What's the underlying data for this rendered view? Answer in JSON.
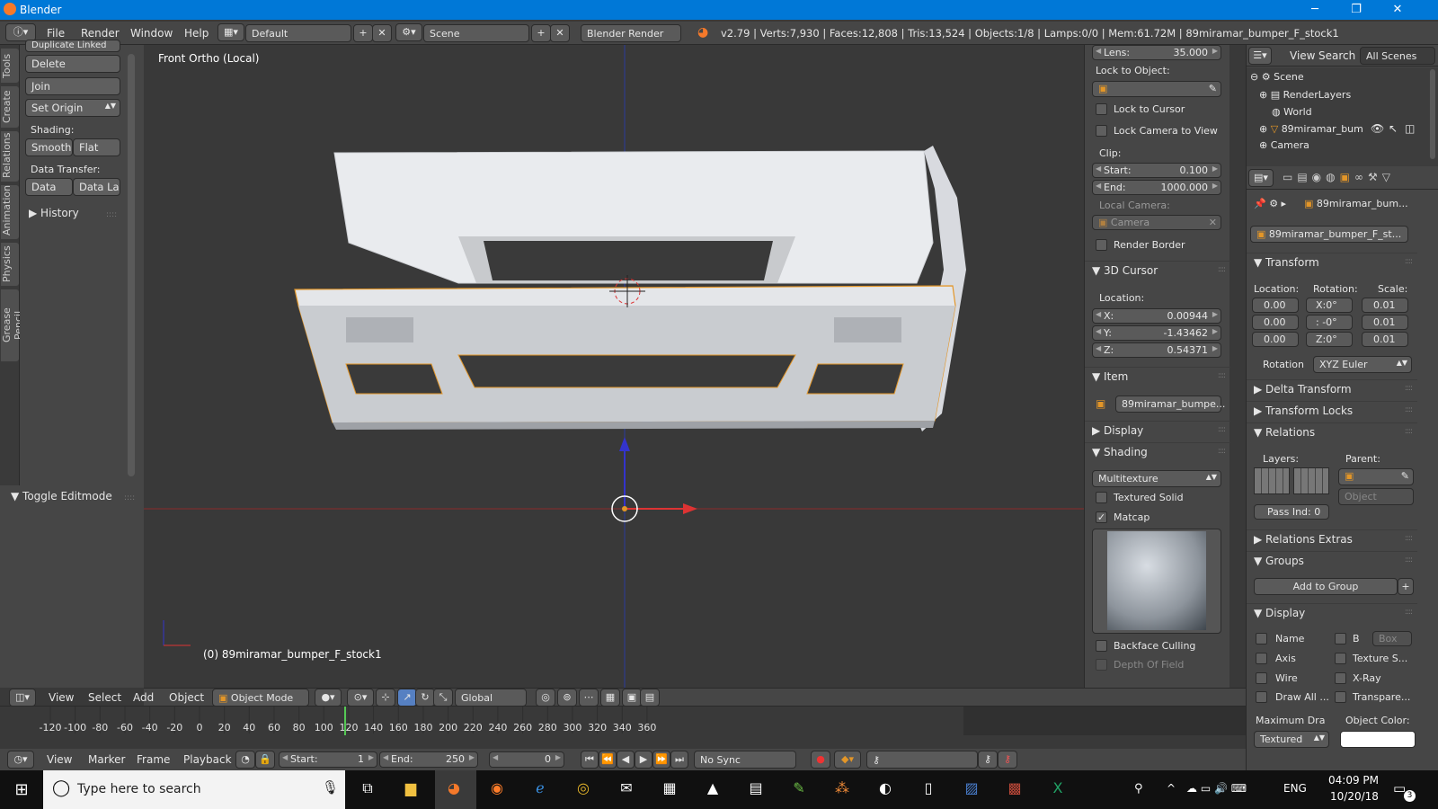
{
  "window": {
    "title": "Blender",
    "min": "─",
    "max": "❐",
    "close": "✕"
  },
  "menu": {
    "file": "File",
    "render": "Render",
    "window": "Window",
    "help": "Help",
    "layout": "Default",
    "scene": "Scene",
    "engine": "Blender Render",
    "stats": "v2.79 | Verts:7,930 | Faces:12,808 | Tris:13,524 | Objects:1/8 | Lamps:0/0 | Mem:61.72M | 89miramar_bumper_F_stock1"
  },
  "tabs": [
    "Tools",
    "Create",
    "Relations",
    "Animation",
    "Physics",
    "Grease Pencil"
  ],
  "tools": {
    "dup": "Duplicate Linked",
    "delete": "Delete",
    "join": "Join",
    "set_origin": "Set Origin",
    "shading_lbl": "Shading:",
    "smooth": "Smooth",
    "flat": "Flat",
    "data_transfer_lbl": "Data Transfer:",
    "data": "Data",
    "data_lay": "Data Lay",
    "history": "History",
    "toggle_editmode": "Toggle Editmode"
  },
  "viewport": {
    "view_name": "Front Ortho (Local)",
    "object_label": "(0) 89miramar_bumper_F_stock1"
  },
  "npanel": {
    "lens_lbl": "Lens:",
    "lens": "35.000",
    "lock_obj": "Lock to Object:",
    "lock_cursor": "Lock to Cursor",
    "lock_camera": "Lock Camera to View",
    "clip": "Clip:",
    "start_lbl": "Start:",
    "start": "0.100",
    "end_lbl": "End:",
    "end": "1000.000",
    "local_camera": "Local Camera:",
    "camera": "Camera",
    "render_border": "Render Border",
    "cursor_head": "3D Cursor",
    "location_lbl": "Location:",
    "x_lbl": "X:",
    "x": "0.00944",
    "y_lbl": "Y:",
    "y": "-1.43462",
    "z_lbl": "Z:",
    "z": "0.54371",
    "item_head": "Item",
    "item_name": "89miramar_bumpe...",
    "display_head": "Display",
    "shading_head": "Shading",
    "shade_mode": "Multitexture",
    "textured_solid": "Textured Solid",
    "matcap": "Matcap",
    "backface": "Backface Culling",
    "dof": "Depth Of Field"
  },
  "outliner": {
    "view": "View",
    "search": "Search",
    "all_scenes": "All Scenes",
    "items": [
      "Scene",
      "RenderLayers",
      "World",
      "89miramar_bum",
      "Camera"
    ]
  },
  "props": {
    "obj_path": "89miramar_bum...",
    "obj_name": "89miramar_bumper_F_st...",
    "transform": "Transform",
    "location": "Location:",
    "rotation": "Rotation:",
    "scale": "Scale:",
    "loc": [
      "0.00",
      "0.00",
      "0.00"
    ],
    "rot": [
      "X:0°",
      ": -0°",
      "Z:0°"
    ],
    "scl": [
      "0.01",
      "0.01",
      "0.01"
    ],
    "rotation_lbl": "Rotation",
    "rot_mode": "XYZ Euler",
    "delta": "Delta Transform",
    "locks": "Transform Locks",
    "relations": "Relations",
    "layers": "Layers:",
    "parent": "Parent:",
    "object_ph": "Object",
    "pass_ind": "Pass Ind:  0",
    "rel_extras": "Relations Extras",
    "groups": "Groups",
    "add_group": "Add to Group",
    "display": "Display",
    "name": "Name",
    "b": "B",
    "box": "Box",
    "axis": "Axis",
    "texture_s": "Texture S...",
    "wire": "Wire",
    "xray": "X-Ray",
    "draw_all": "Draw All ...",
    "transp": "Transpare...",
    "max_draw": "Maximum Dra",
    "obj_color": "Object Color:",
    "textured": "Textured"
  },
  "vbar": {
    "view": "View",
    "select": "Select",
    "add": "Add",
    "object": "Object",
    "mode": "Object Mode",
    "orientation": "Global"
  },
  "timeline": {
    "ticks": [
      "-120",
      "-100",
      "-80",
      "-60",
      "-40",
      "-20",
      "0",
      "20",
      "40",
      "60",
      "80",
      "100",
      "120",
      "140",
      "160",
      "180",
      "200",
      "220",
      "240",
      "260",
      "280",
      "300",
      "320",
      "340",
      "360"
    ],
    "view": "View",
    "marker": "Marker",
    "frame": "Frame",
    "playback": "Playback",
    "start_lbl": "Start:",
    "start": "1",
    "end_lbl": "End:",
    "end": "250",
    "current": "0",
    "sync": "No Sync"
  },
  "taskbar": {
    "search": "Type here to search",
    "lang": "ENG",
    "time": "04:09 PM",
    "date": "10/20/18",
    "notif": "3"
  }
}
